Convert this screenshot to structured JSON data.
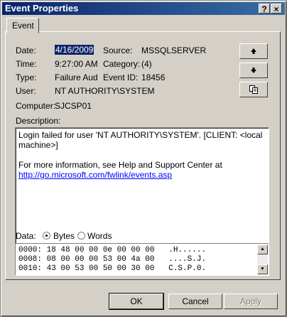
{
  "window": {
    "title": "Event Properties",
    "help_glyph": "?",
    "close_glyph": "×"
  },
  "tabs": [
    {
      "label": "Event"
    }
  ],
  "fields": {
    "date_label": "Date:",
    "date_value": "4/16/2009",
    "source_label": "Source:",
    "source_value": "MSSQLSERVER",
    "time_label": "Time:",
    "time_value": "9:27:00 AM",
    "category_label": "Category:",
    "category_value": "(4)",
    "type_label": "Type:",
    "type_value": "Failure Aud",
    "eventid_label": "Event ID:",
    "eventid_value": "18456",
    "user_label": "User:",
    "user_value": "NT AUTHORITY\\SYSTEM",
    "computer_label": "Computer:",
    "computer_value": "SJCSP01"
  },
  "description": {
    "label": "Description:",
    "line1": "Login failed for user 'NT AUTHORITY\\SYSTEM'. [CLIENT: <local",
    "line2": "machine>]",
    "line3": "For more information, see Help and Support Center at",
    "link": "http://go.microsoft.com/fwlink/events.asp"
  },
  "data": {
    "label": "Data:",
    "bytes_label": "Bytes",
    "words_label": "Words",
    "selected": "Bytes",
    "rows": [
      "0000: 18 48 00 00 0e 00 00 00   .H......",
      "0008: 08 00 00 00 53 00 4a 00   ....S.J.",
      "0010: 43 00 53 00 50 00 30 00   C.S.P.0."
    ]
  },
  "side_buttons": {
    "up_icon": "arrow-up-icon",
    "down_icon": "arrow-down-icon",
    "copy_icon": "copy-icon"
  },
  "buttons": {
    "ok": "OK",
    "cancel": "Cancel",
    "apply": "Apply"
  },
  "colors": {
    "titlebar": "#0a246a",
    "face": "#d4d0c8",
    "selection": "#0a246a",
    "link": "#0000ff"
  }
}
